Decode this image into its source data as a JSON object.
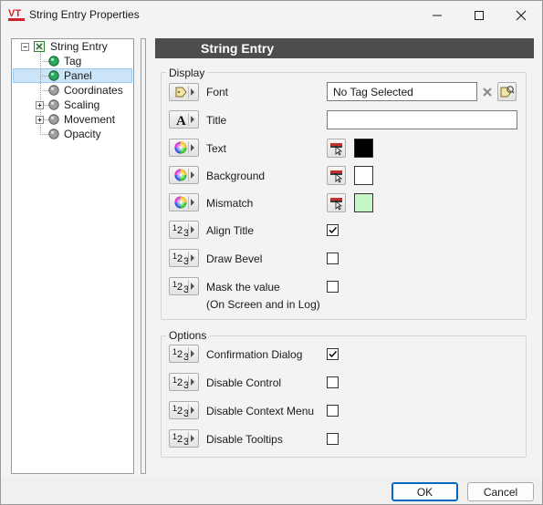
{
  "window": {
    "title": "String Entry Properties"
  },
  "tree": {
    "root": "String Entry",
    "items": [
      "Tag",
      "Panel",
      "Coordinates",
      "Scaling",
      "Movement",
      "Opacity"
    ]
  },
  "header": {
    "title": "String Entry"
  },
  "display": {
    "group_title": "Display",
    "font_label": "Font",
    "tag_value": "No Tag Selected",
    "title_label": "Title",
    "title_value": "",
    "text_label": "Text",
    "background_label": "Background",
    "mismatch_label": "Mismatch",
    "align_title_label": "Align Title",
    "draw_bevel_label": "Draw Bevel",
    "mask_label_line1": "Mask the value",
    "mask_label_line2": "(On Screen and in Log)",
    "colors": {
      "text": "#000000",
      "background": "#ffffff",
      "mismatch": "#c6f5c6"
    },
    "checks": {
      "align_title": true,
      "draw_bevel": false,
      "mask": false
    }
  },
  "options": {
    "group_title": "Options",
    "confirmation_label": "Confirmation Dialog",
    "disable_control_label": "Disable Control",
    "disable_context_label": "Disable Context Menu",
    "disable_tooltips_label": "Disable Tooltips",
    "checks": {
      "confirmation": true,
      "disable_control": false,
      "disable_context": false,
      "disable_tooltips": false
    }
  },
  "buttons": {
    "ok": "OK",
    "cancel": "Cancel"
  }
}
